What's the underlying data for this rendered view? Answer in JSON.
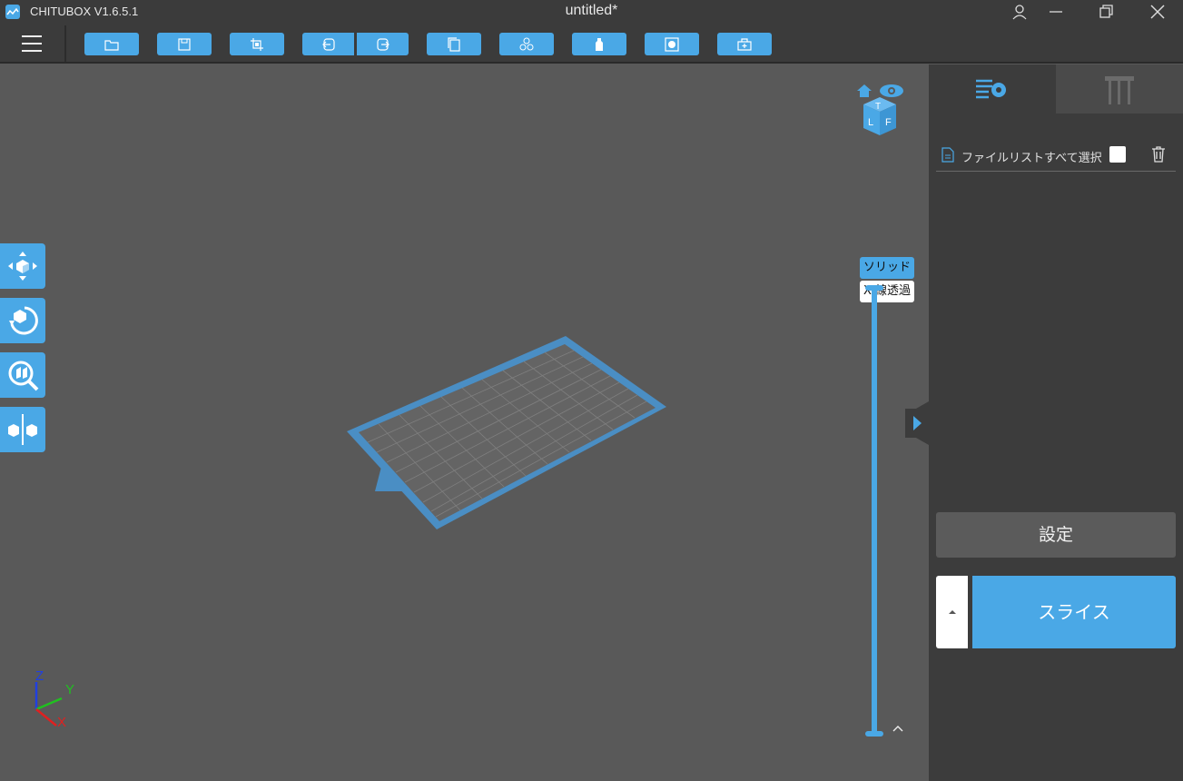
{
  "titlebar": {
    "app_name": "CHITUBOX V1.6.5.1",
    "document_title": "untitled*",
    "controls": [
      "user-icon",
      "minimize-icon",
      "restore-icon",
      "close-icon"
    ]
  },
  "toolbar": {
    "buttons": [
      {
        "name": "open-file",
        "icon": "folder-icon"
      },
      {
        "name": "save",
        "icon": "floppy-icon"
      },
      {
        "name": "crop",
        "icon": "crop-icon"
      },
      {
        "name": "undo",
        "icon": "undo-icon"
      },
      {
        "name": "redo",
        "icon": "redo-icon"
      },
      {
        "name": "copy",
        "icon": "copy-icon"
      },
      {
        "name": "arrange",
        "icon": "arrange-icon"
      },
      {
        "name": "hollow",
        "icon": "bottle-icon"
      },
      {
        "name": "drill",
        "icon": "hole-icon"
      },
      {
        "name": "repair",
        "icon": "toolbox-icon"
      }
    ]
  },
  "viewport": {
    "view_modes": {
      "solid": "ソリッド",
      "xray": "X 線透過"
    },
    "axes": {
      "x": "X",
      "y": "Y",
      "z": "Z"
    },
    "colors": {
      "accent": "#4aa8e6",
      "axis_x": "#e02020",
      "axis_y": "#20c020",
      "axis_z": "#2040e0"
    }
  },
  "left_tools": [
    {
      "name": "move",
      "icon": "move-icon"
    },
    {
      "name": "rotate",
      "icon": "rotate-icon"
    },
    {
      "name": "scale",
      "icon": "scale-icon"
    },
    {
      "name": "mirror",
      "icon": "mirror-icon"
    }
  ],
  "panel": {
    "file_list_label": "ファイルリストすべて選択",
    "settings_label": "設定",
    "slice_label": "スライス"
  }
}
